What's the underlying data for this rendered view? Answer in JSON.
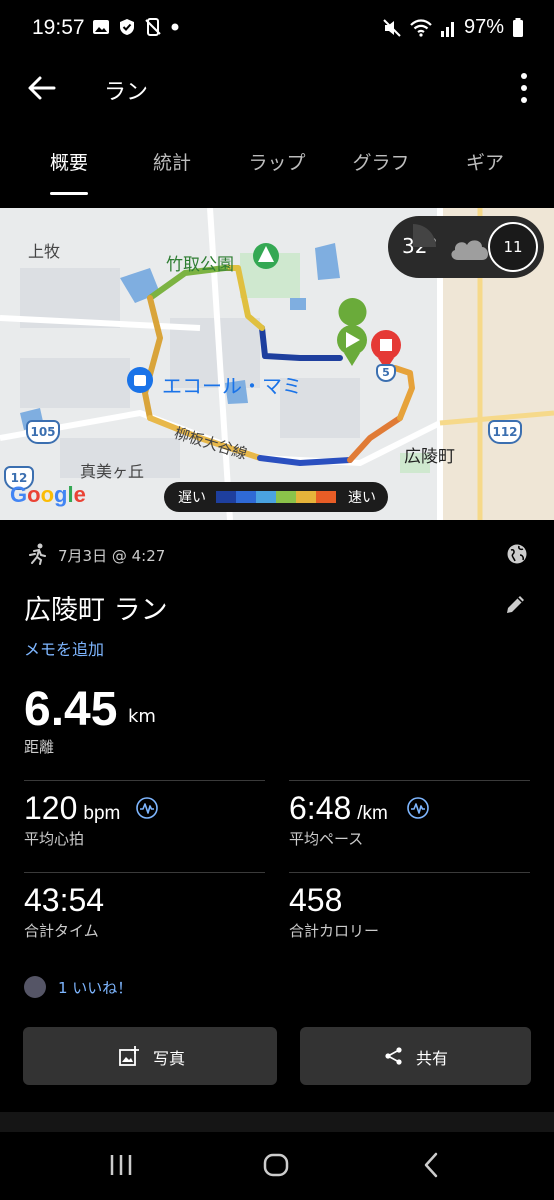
{
  "status_bar": {
    "time": "19:57",
    "battery": "97%",
    "left_icons": [
      "image-icon",
      "shield-check-icon",
      "no-phone-icon",
      "dot-icon"
    ],
    "right_icons": [
      "mute-icon",
      "wifi-icon",
      "signal-icon",
      "battery-icon"
    ]
  },
  "appbar": {
    "title": "ラン"
  },
  "tabs": [
    {
      "label": "概要",
      "active": true
    },
    {
      "label": "統計"
    },
    {
      "label": "ラップ"
    },
    {
      "label": "グラフ"
    },
    {
      "label": "ギア"
    }
  ],
  "map": {
    "labels": {
      "kamimaki": "上牧",
      "park": "竹取公園",
      "store": "エコール・マミ",
      "road": "柳板大谷線",
      "mamigaoka": "真美ヶ丘",
      "koryo": "広陵町"
    },
    "route_badges": {
      "r105": "105",
      "r12": "12",
      "r112": "112",
      "r5": "5"
    },
    "weather": {
      "temp": "32°",
      "dial": "11"
    },
    "legend": {
      "slow": "遅い",
      "fast": "速い"
    },
    "google": "Google",
    "colors": {
      "slow": "#1e3f9e",
      "fast": "#e85d26",
      "start": "#6aab3a",
      "stop": "#e53935"
    }
  },
  "activity": {
    "date": "7月3日 @ 4:27",
    "title": "広陵町 ラン",
    "memo": "メモを追加"
  },
  "distance": {
    "value": "6.45",
    "unit": "km",
    "label": "距離"
  },
  "stats": {
    "heart": {
      "value": "120",
      "unit": "bpm",
      "label": "平均心拍"
    },
    "pace": {
      "value": "6:48",
      "unit": "/km",
      "label": "平均ペース"
    },
    "time": {
      "value": "43:54",
      "label": "合計タイム"
    },
    "calories": {
      "value": "458",
      "label": "合計カロリー"
    }
  },
  "likes": {
    "text": "1 いいね！"
  },
  "buttons": {
    "photo": "写真",
    "share": "共有"
  }
}
